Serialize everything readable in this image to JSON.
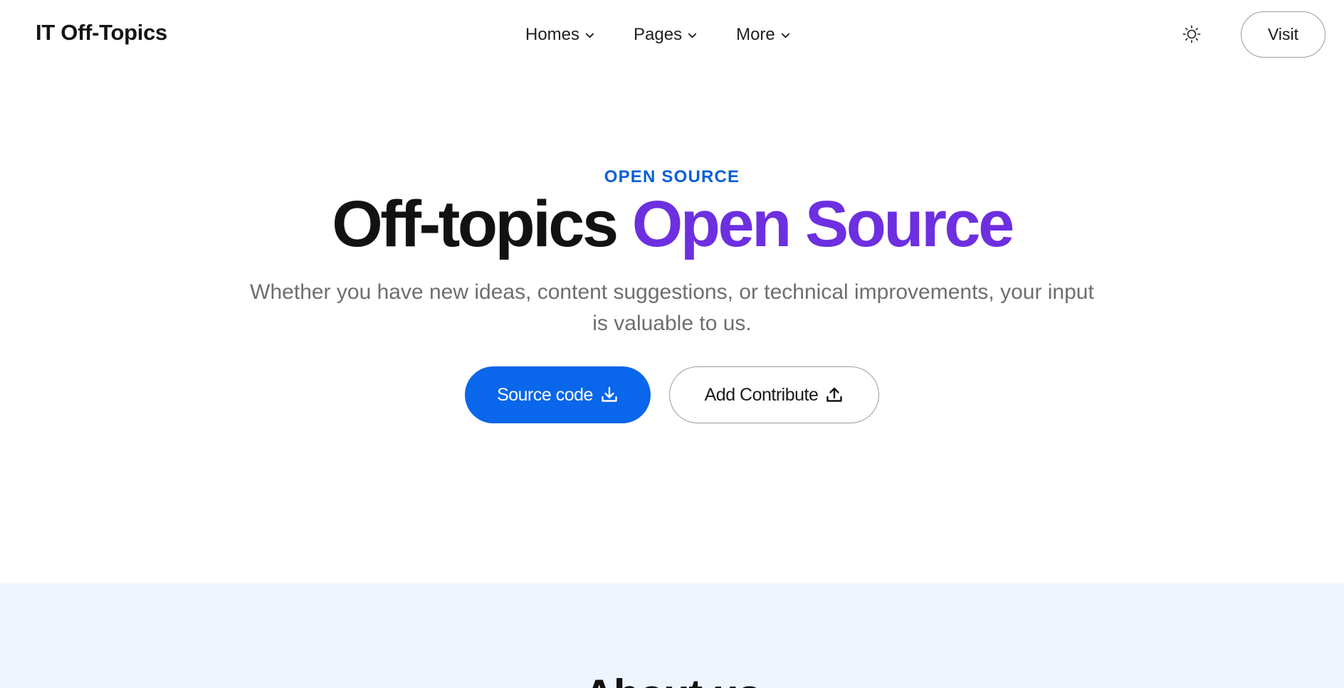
{
  "header": {
    "brand": "IT Off-Topics",
    "nav": [
      {
        "label": "Homes"
      },
      {
        "label": "Pages"
      },
      {
        "label": "More"
      }
    ],
    "theme_icon": "sun-icon",
    "visit_label": "Visit"
  },
  "hero": {
    "eyebrow": "OPEN SOURCE",
    "title_main": "Off-topics",
    "title_accent": "Open Source",
    "subtitle": "Whether you have new ideas, content suggestions, or technical improvements, your input is valuable to us.",
    "primary_button": {
      "label": "Source code",
      "icon": "download-icon"
    },
    "secondary_button": {
      "label": "Add Contribute",
      "icon": "upload-icon"
    }
  },
  "about": {
    "title": "About us"
  },
  "colors": {
    "accent_blue": "#0a66ea",
    "eyebrow_blue": "#0a5fd6",
    "title_purple": "#6d2fe0",
    "about_bg": "#eef5fd"
  }
}
